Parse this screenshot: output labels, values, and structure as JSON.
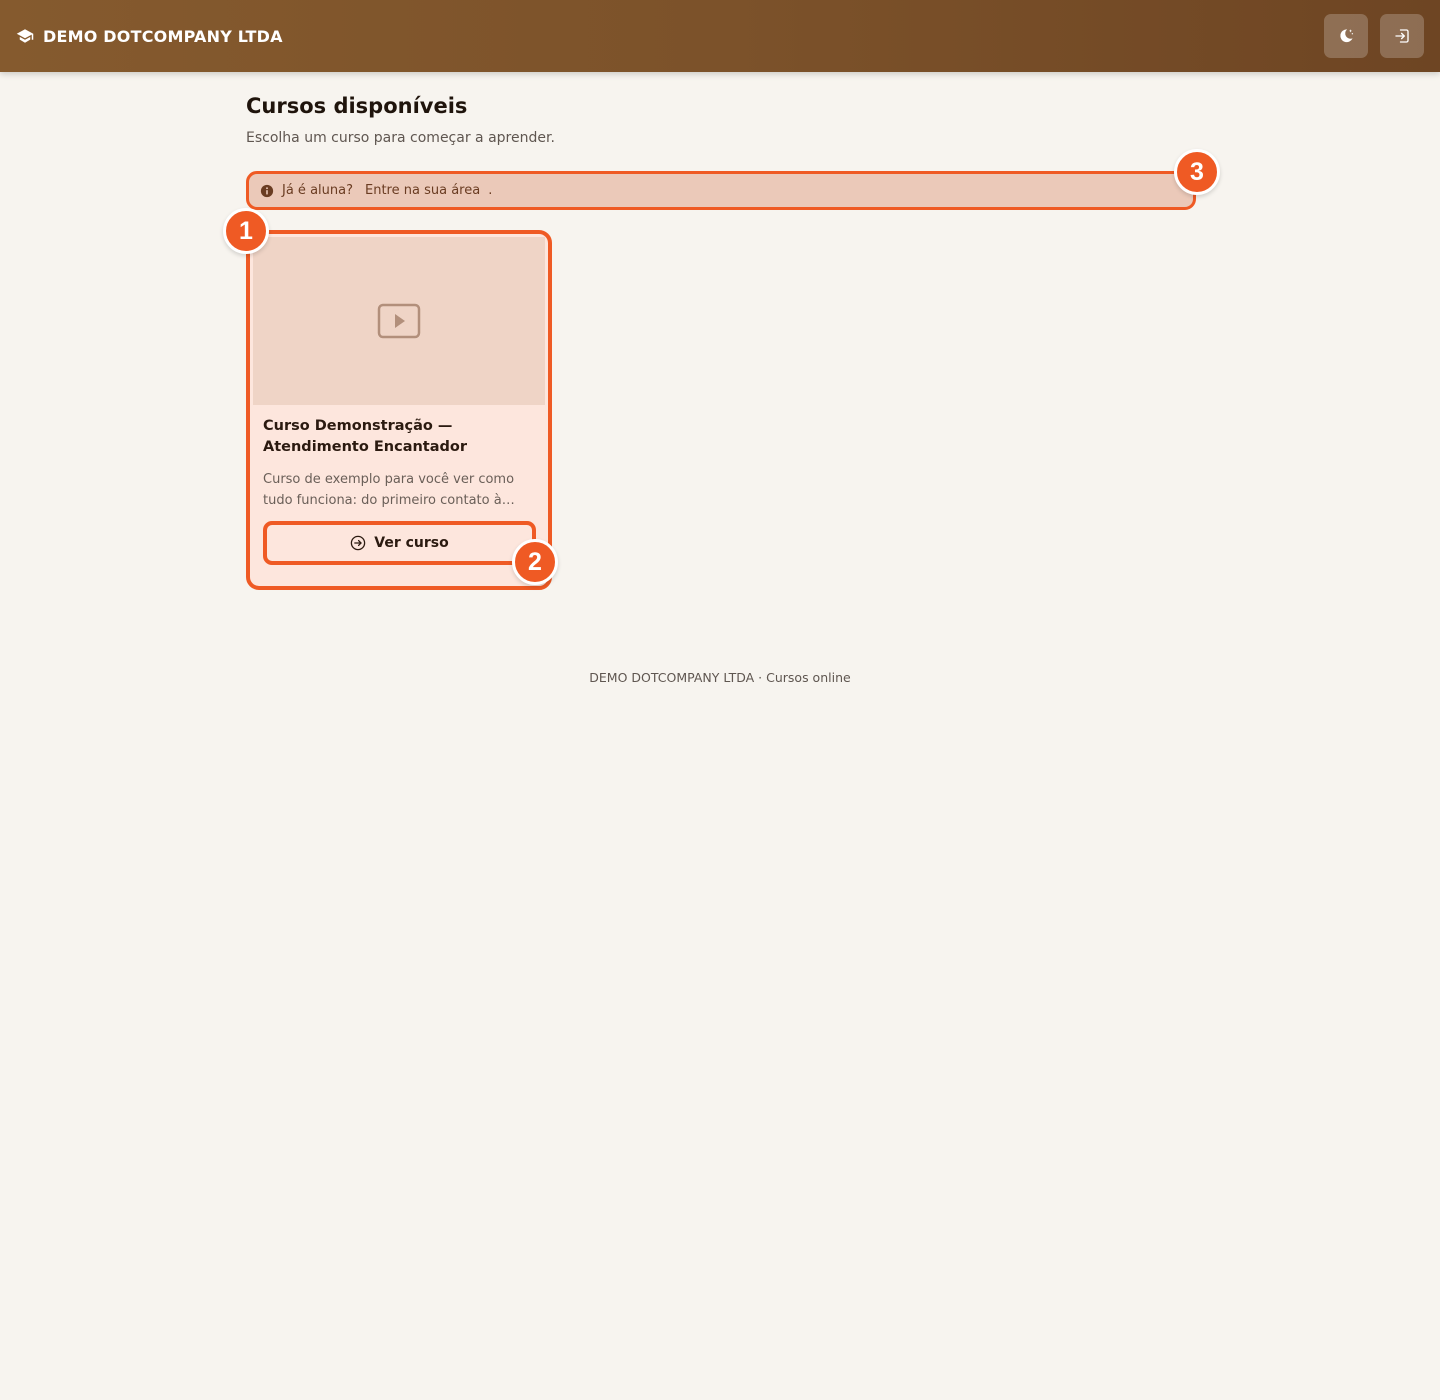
{
  "header": {
    "brand_icon": "graduation-cap-icon",
    "brand_name": "DEMO DOTCOMPANY LTDA",
    "theme_button_icon": "moon-stars-icon",
    "login_button_icon": "sign-in-icon"
  },
  "main": {
    "title": "Cursos disponíveis",
    "subtitle": "Escolha um curso para começar a aprender."
  },
  "alert": {
    "icon": "info-circle-icon",
    "text": "Já é aluna?",
    "link_text": "Entre na sua área",
    "trailing": "."
  },
  "courses": [
    {
      "thumbnail_icon": "video-play-icon",
      "title": "Curso Demonstração — Atendimento Encantador",
      "description": "Curso de exemplo para você ver como tudo funciona: do primeiro contato à fidelização do cliente.",
      "button_icon": "arrow-right-circle-icon",
      "button_label": "Ver curso"
    }
  ],
  "annotations": {
    "badge_1": "1",
    "badge_2": "2",
    "badge_3": "3"
  },
  "footer": {
    "text": "DEMO DOTCOMPANY LTDA · Cursos online"
  },
  "colors": {
    "header_gradient_start": "#855a2e",
    "header_gradient_end": "#6e4523",
    "accent": "#ef5a24",
    "page_background": "#f7f4ef",
    "card_background": "#fde6dd",
    "alert_background": "#ebc9b9"
  }
}
